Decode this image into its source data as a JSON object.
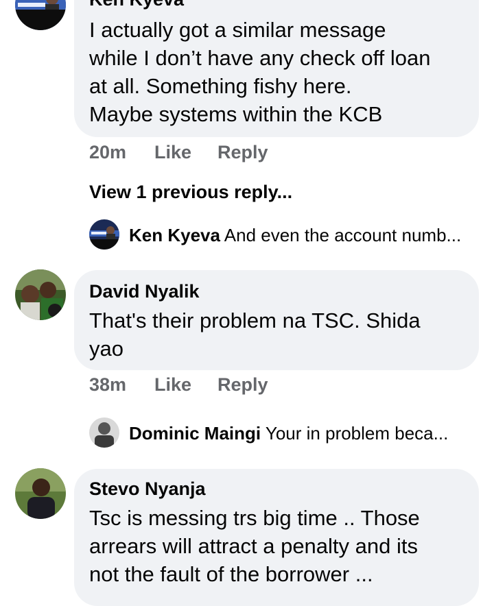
{
  "comments": [
    {
      "author": "Ken Kyeva",
      "lines": [
        "I actually got a similar message",
        "while I don’t have any check off loan",
        "at all. Something fishy here.",
        "Maybe systems within the KCB"
      ],
      "time": "20m",
      "like": "Like",
      "reply": "Reply",
      "view_previous": "View 1 previous reply...",
      "reply_preview": {
        "name": "Ken Kyeva",
        "text": "And even the account numb..."
      }
    },
    {
      "author": "David Nyalik",
      "lines": [
        "That's their problem na TSC. Shida",
        "yao"
      ],
      "time": "38m",
      "like": "Like",
      "reply": "Reply",
      "reply_preview": {
        "name": "Dominic Maingi",
        "text": "Your in problem beca..."
      }
    },
    {
      "author": "Stevo Nyanja",
      "lines": [
        "Tsc is messing trs big time .. Those",
        "arrears will attract a penalty and its",
        "not the fault of the borrower ..."
      ]
    }
  ],
  "colors": {
    "bubble": "#f0f2f5",
    "meta_text": "#65676b",
    "text": "#050505"
  }
}
